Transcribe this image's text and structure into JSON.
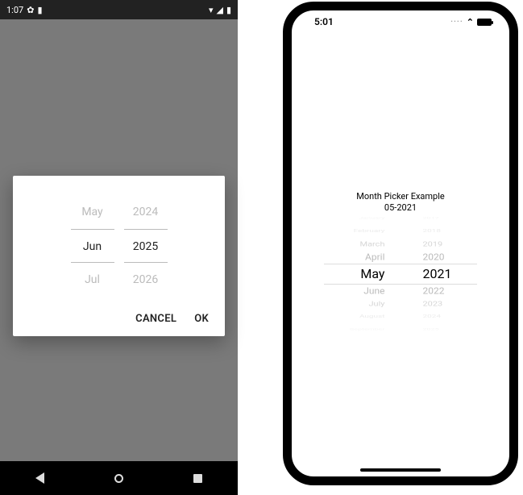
{
  "android": {
    "statusbar": {
      "time": "1:07",
      "icons_left": [
        "gear-icon",
        "sim-icon"
      ],
      "icons_right": [
        "wifi-icon",
        "signal-icon",
        "battery-icon"
      ]
    },
    "dialog": {
      "month_col": {
        "above": "May",
        "selected": "Jun",
        "below": "Jul"
      },
      "year_col": {
        "above": "2024",
        "selected": "2025",
        "below": "2026"
      },
      "cancel_label": "CANCEL",
      "ok_label": "OK"
    }
  },
  "ios": {
    "statusbar": {
      "time": "5:01"
    },
    "title": "Month Picker Example",
    "subtitle": "05-2021",
    "picker": {
      "months": [
        "January",
        "February",
        "March",
        "April",
        "May",
        "June",
        "July",
        "August",
        "September"
      ],
      "years": [
        "2017",
        "2018",
        "2019",
        "2020",
        "2021",
        "2022",
        "2023",
        "2024",
        "2025"
      ],
      "selected_index": 4
    }
  }
}
